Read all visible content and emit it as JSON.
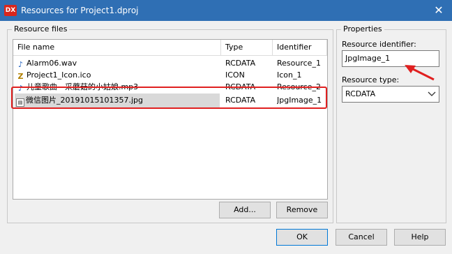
{
  "window": {
    "app_icon": "DX",
    "title": "Resources for Project1.dproj",
    "close_glyph": "✕"
  },
  "resource_files": {
    "group_label": "Resource files",
    "columns": [
      "File name",
      "Type",
      "Identifier"
    ],
    "rows": [
      {
        "name": "Alarm06.wav",
        "type": "RCDATA",
        "identifier": "Resource_1",
        "icon": "audio-file-icon"
      },
      {
        "name": "Project1_Icon.ico",
        "type": "ICON",
        "identifier": "Icon_1",
        "icon": "ico-file-icon"
      },
      {
        "name": "儿童歌曲 - 采蘑菇的小姑娘.mp3",
        "type": "RCDATA",
        "identifier": "Resource_2",
        "icon": "audio-file-icon"
      },
      {
        "name": "微信图片_20191015101357.jpg",
        "type": "RCDATA",
        "identifier": "JpgImage_1",
        "icon": "image-file-icon"
      }
    ],
    "add_label": "Add...",
    "remove_label": "Remove"
  },
  "properties": {
    "group_label": "Properties",
    "identifier_label": "Resource identifier:",
    "identifier_value": "JpgImage_1",
    "type_label": "Resource type:",
    "type_value": "RCDATA"
  },
  "footer": {
    "ok_label": "OK",
    "cancel_label": "Cancel",
    "help_label": "Help"
  },
  "colors": {
    "titlebar": "#2f6fb4",
    "annotation": "#e02020"
  }
}
